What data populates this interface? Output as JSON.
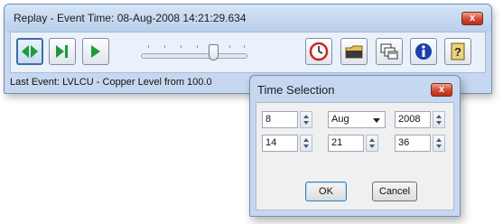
{
  "main_window": {
    "title": "Replay - Event Time: 08-Aug-2008 14:21:29.634",
    "close_label": "x",
    "status_text": "Last Event: LVLCU - Copper Level from 100.0",
    "toolbar": {
      "buttons": [
        {
          "name": "play-both-directions-button",
          "icon": "double-arrow-icon"
        },
        {
          "name": "step-forward-button",
          "icon": "step-forward-icon"
        },
        {
          "name": "play-button",
          "icon": "play-icon"
        },
        {
          "name": "clock-button",
          "icon": "clock-icon"
        },
        {
          "name": "open-folder-button",
          "icon": "folder-icon"
        },
        {
          "name": "windows-button",
          "icon": "windows-icon"
        },
        {
          "name": "info-button",
          "icon": "info-icon"
        },
        {
          "name": "help-button",
          "icon": "help-icon"
        }
      ],
      "slider_position": 0.64
    }
  },
  "time_dialog": {
    "title": "Time Selection",
    "close_label": "x",
    "date": {
      "day": "8",
      "month": "Aug",
      "year": "2008"
    },
    "time": {
      "hour": "14",
      "minute": "21",
      "second": "36"
    },
    "ok_label": "OK",
    "cancel_label": "Cancel"
  },
  "colors": {
    "frame": "#c5d8ef",
    "accent_green": "#1f9a3a",
    "close_red": "#d04830",
    "info_blue": "#1a3fa8"
  }
}
